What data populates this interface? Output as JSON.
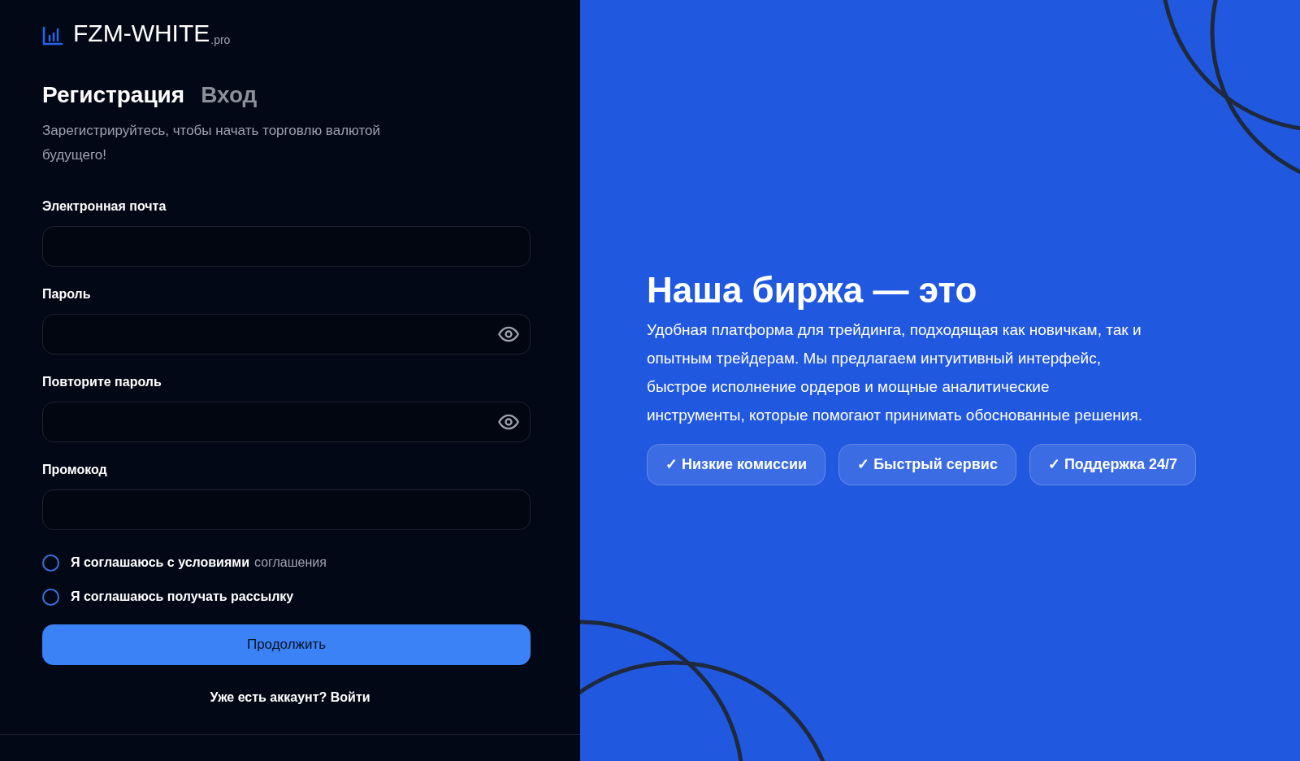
{
  "logo": {
    "name": "FZM-WHITE",
    "suffix": ".pro"
  },
  "tabs": [
    {
      "label": "Регистрация",
      "selected": true
    },
    {
      "label": "Вход",
      "selected": false
    }
  ],
  "subtitle": "Зарегистрируйтесь, чтобы начать торговлю валютой будущего!",
  "fields": [
    {
      "label": "Электронная почта",
      "kind": "text"
    },
    {
      "label": "Пароль",
      "kind": "password"
    },
    {
      "label": "Повторите пароль",
      "kind": "password"
    },
    {
      "label": "Промокод",
      "kind": "text"
    }
  ],
  "agreements": [
    {
      "text": "Я соглашаюсь с условиями",
      "link": "соглашения",
      "checked": false
    },
    {
      "text": "Я соглашаюсь получать рассылку",
      "checked": false
    }
  ],
  "submit": "Продолжить",
  "login_link": "Уже есть аккаунт? Войти",
  "promo": {
    "title": "Наша биржа — это",
    "text": "Удобная платформа для трейдинга, подходящая как новичкам, так и опытным трейдерам. Мы предлагаем интуитивный интерфейс, быстрое исполнение ордеров и мощные аналитические инструменты, которые помогают принимать обоснованные решения.",
    "features": [
      "✓ Низкие комиссии",
      "✓ Быстрый сервис",
      "✓ Поддержка 24/7"
    ]
  }
}
